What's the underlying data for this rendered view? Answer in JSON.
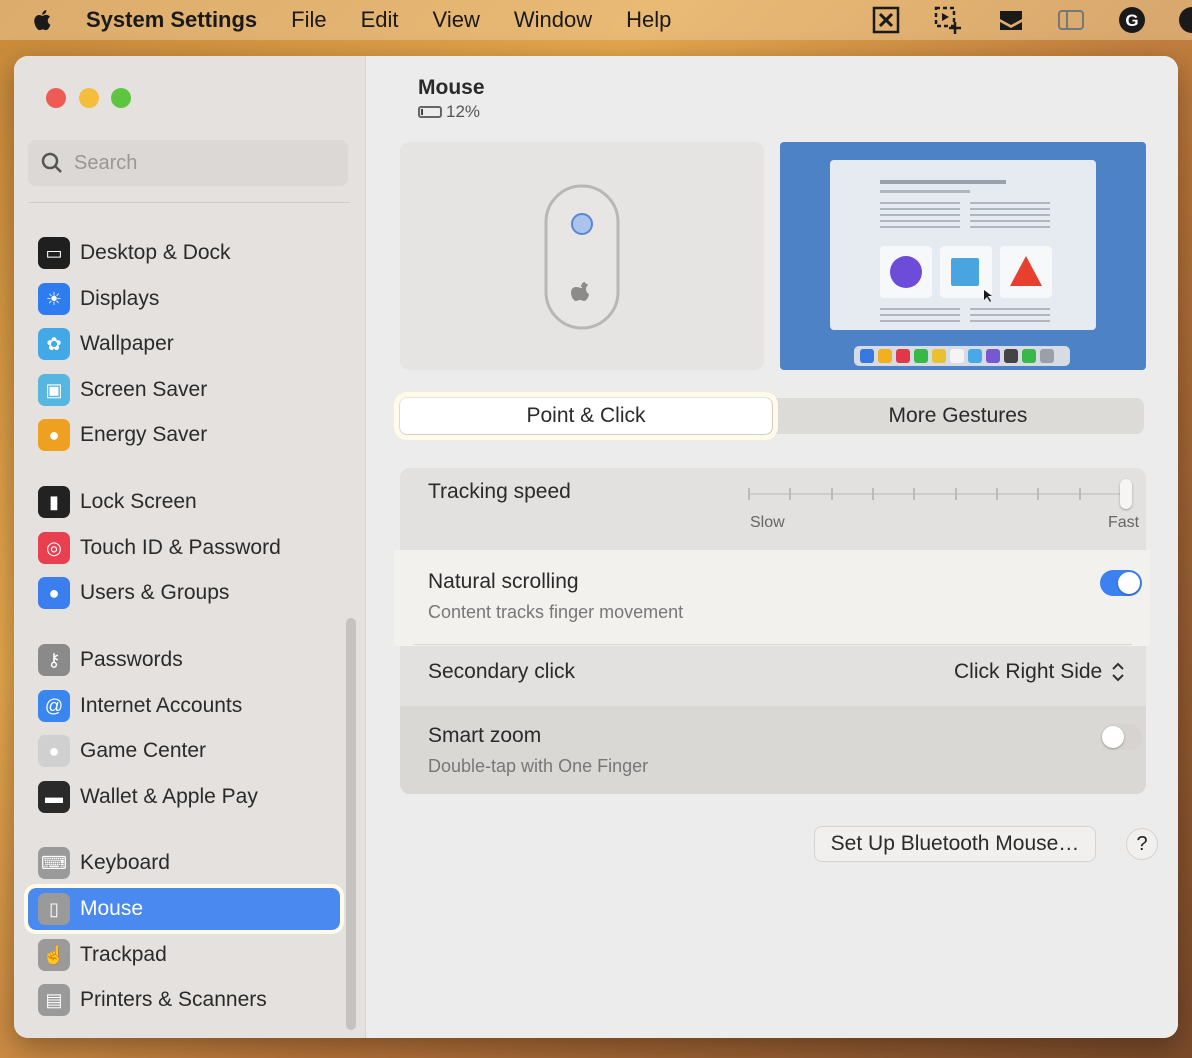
{
  "menubar": {
    "app_name": "System Settings",
    "items": [
      "File",
      "Edit",
      "View",
      "Window",
      "Help"
    ],
    "status_icons": [
      "compress-icon",
      "screenshot-icon",
      "inbox-tray-icon",
      "sidebar-toggle-icon",
      "grammarly-icon"
    ]
  },
  "search": {
    "placeholder": "Search"
  },
  "sidebar": {
    "items": [
      {
        "label": "Desktop & Dock",
        "icon": "dock-icon",
        "color": "#1f1f1f"
      },
      {
        "label": "Displays",
        "icon": "sun-icon",
        "color": "#2f7cf0"
      },
      {
        "label": "Wallpaper",
        "icon": "flower-icon",
        "color": "#42a8e8"
      },
      {
        "label": "Screen Saver",
        "icon": "screensaver-icon",
        "color": "#56b6e0"
      },
      {
        "label": "Energy Saver",
        "icon": "bulb-icon",
        "color": "#f0a020"
      },
      {
        "label": "Lock Screen",
        "icon": "lock-icon",
        "color": "#222222"
      },
      {
        "label": "Touch ID & Password",
        "icon": "fingerprint-icon",
        "color": "#e84050"
      },
      {
        "label": "Users & Groups",
        "icon": "users-icon",
        "color": "#3a7ef0"
      },
      {
        "label": "Passwords",
        "icon": "key-icon",
        "color": "#8a8a8a"
      },
      {
        "label": "Internet Accounts",
        "icon": "at-icon",
        "color": "#3a86f0"
      },
      {
        "label": "Game Center",
        "icon": "game-center-icon",
        "color": "#d0d0d0"
      },
      {
        "label": "Wallet & Apple Pay",
        "icon": "wallet-icon",
        "color": "#2a2a2a"
      },
      {
        "label": "Keyboard",
        "icon": "keyboard-icon",
        "color": "#9a9a9a"
      },
      {
        "label": "Mouse",
        "icon": "mouse-icon",
        "color": "#9a9a9a"
      },
      {
        "label": "Trackpad",
        "icon": "trackpad-icon",
        "color": "#9a9a9a"
      },
      {
        "label": "Printers & Scanners",
        "icon": "printer-icon",
        "color": "#9a9a9a"
      }
    ],
    "selected": "Mouse"
  },
  "content": {
    "title": "Mouse",
    "battery": "12%",
    "battery_level": 0.12,
    "tabs": [
      "Point & Click",
      "More Gestures"
    ],
    "active_tab": "Point & Click",
    "tracking": {
      "label": "Tracking speed",
      "min_label": "Slow",
      "max_label": "Fast",
      "value": 1.0
    },
    "natural_scrolling": {
      "label": "Natural scrolling",
      "sub": "Content tracks finger movement",
      "on": true
    },
    "secondary_click": {
      "label": "Secondary click",
      "value": "Click Right Side"
    },
    "smart_zoom": {
      "label": "Smart zoom",
      "sub": "Double-tap with One Finger",
      "on": false
    },
    "setup_button": "Set Up Bluetooth Mouse…",
    "help_button": "?"
  },
  "colors": {
    "accent": "#4a8af0",
    "toggle_on": "#3b82f0",
    "toggle_off": "#d6d3d0"
  }
}
